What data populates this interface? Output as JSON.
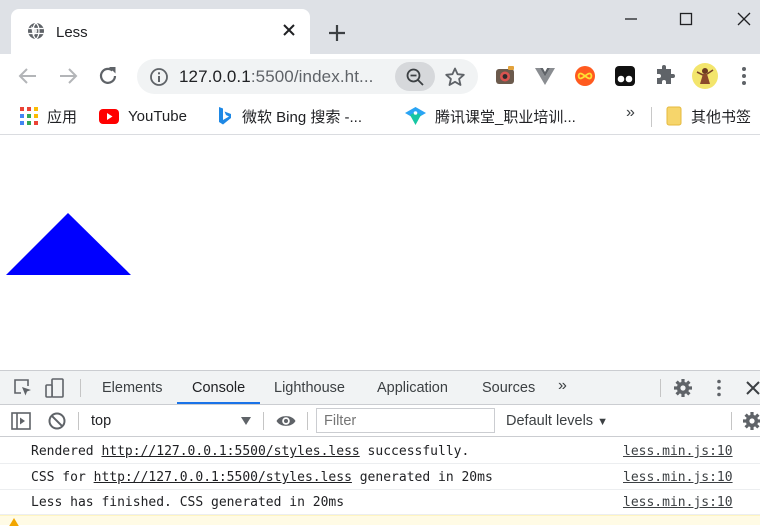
{
  "window": {
    "tab_title": "Less",
    "buttons": {
      "minimize": "minimize-icon",
      "maximize": "maximize-icon",
      "close": "close-icon"
    }
  },
  "toolbar": {
    "url_host": "127.0.0.1",
    "url_rest": ":5500/index.ht..."
  },
  "bookmarks": {
    "items": [
      {
        "label": "应用",
        "icon": "apps-grid-icon"
      },
      {
        "label": "YouTube",
        "icon": "youtube-icon"
      },
      {
        "label": "微软 Bing 搜索 -...",
        "icon": "bing-icon"
      },
      {
        "label": "腾讯课堂_职业培训...",
        "icon": "tencent-classroom-icon"
      }
    ],
    "overflow": "»",
    "other_bookmarks": "其他书签"
  },
  "page": {
    "shape": "triangle",
    "shape_color": "#0000ff"
  },
  "devtools": {
    "tabs": [
      "Elements",
      "Console",
      "Lighthouse",
      "Application",
      "Sources"
    ],
    "active_tab": "Console",
    "more_tabs": "»",
    "context": "top",
    "filter_placeholder": "Filter",
    "levels": "Default levels",
    "levels_arrow": "▼",
    "messages": [
      {
        "before": "Rendered ",
        "link": "http://127.0.0.1:5500/styles.less",
        "after": " successfully.",
        "source": "less.min.js:10"
      },
      {
        "before": "CSS for ",
        "link": "http://127.0.0.1:5500/styles.less",
        "after": " generated in 20ms",
        "source": "less.min.js:10"
      },
      {
        "before": "Less has finished. CSS generated in 20ms",
        "link": "",
        "after": "",
        "source": "less.min.js:10"
      }
    ]
  },
  "colors": {
    "accent": "#1a73e8",
    "tabstrip": "#dee1e6",
    "omnibox": "#f1f3f4"
  }
}
